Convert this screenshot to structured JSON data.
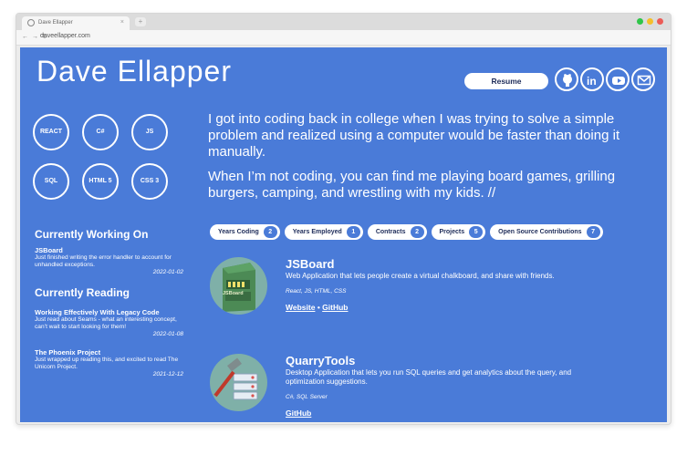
{
  "browser": {
    "tab_title": "Dave Ellapper",
    "tab_close": "×",
    "new_tab": "+",
    "nav": "← → ↻",
    "url": "daveellapper.com",
    "lights": [
      "#2fc548",
      "#f4bf2b",
      "#ec5b56"
    ]
  },
  "header": {
    "name": "Dave Ellapper",
    "resume_label": "Resume",
    "social": [
      "github-icon",
      "linkedin-icon",
      "youtube-icon",
      "email-icon"
    ]
  },
  "skills": [
    "REACT",
    "C#",
    "JS",
    "SQL",
    "HTML 5",
    "CSS 3"
  ],
  "intro": {
    "p1": "I got into coding back in college when I was trying to solve a simple problem and realized using a computer would be faster than doing it manually.",
    "p2": "When I’m not coding, you can find me playing board games, grilling burgers, camping, and wrestling with my kids. //"
  },
  "working_on": {
    "heading": "Currently Working On",
    "items": [
      {
        "title": "JSBoard",
        "text": "Just finished writing the error handler to account for unhandled exceptions.",
        "date": "2022-01-02"
      }
    ]
  },
  "reading": {
    "heading": "Currently Reading",
    "items": [
      {
        "title": "Working Effectively With Legacy Code",
        "text": "Just read about Seams - what an interesting concept, can’t wait to start looking for them!",
        "date": "2022-01-08"
      },
      {
        "title": "The Phoenix Project",
        "text": "Just wrapped up reading this, and excited to read The Unicorn Project.",
        "date": "2021-12-12"
      }
    ]
  },
  "stats": [
    {
      "label": "Years Coding",
      "count": "2"
    },
    {
      "label": "Years Employed",
      "count": "1"
    },
    {
      "label": "Contracts",
      "count": "2"
    },
    {
      "label": "Projects",
      "count": "5"
    },
    {
      "label": "Open Source Contributions",
      "count": "7"
    }
  ],
  "projects": [
    {
      "title": "JSBoard",
      "description": "Web Application that lets people create a virtual chalkboard, and share with friends.",
      "tech": "React, JS, HTML, CSS",
      "thumb_label": "JSBoard",
      "link1": "Website",
      "separator": "•",
      "link2": "GitHub"
    },
    {
      "title": "QuarryTools",
      "description": "Desktop Application that lets you run SQL queries and get analytics about the query, and optimization suggestions.",
      "tech": "C#, SQL Server",
      "link1": "GitHub"
    }
  ],
  "colors": {
    "page_bg": "#4a7bd8",
    "text": "#ffffff",
    "pill_text": "#1f2d5a"
  }
}
